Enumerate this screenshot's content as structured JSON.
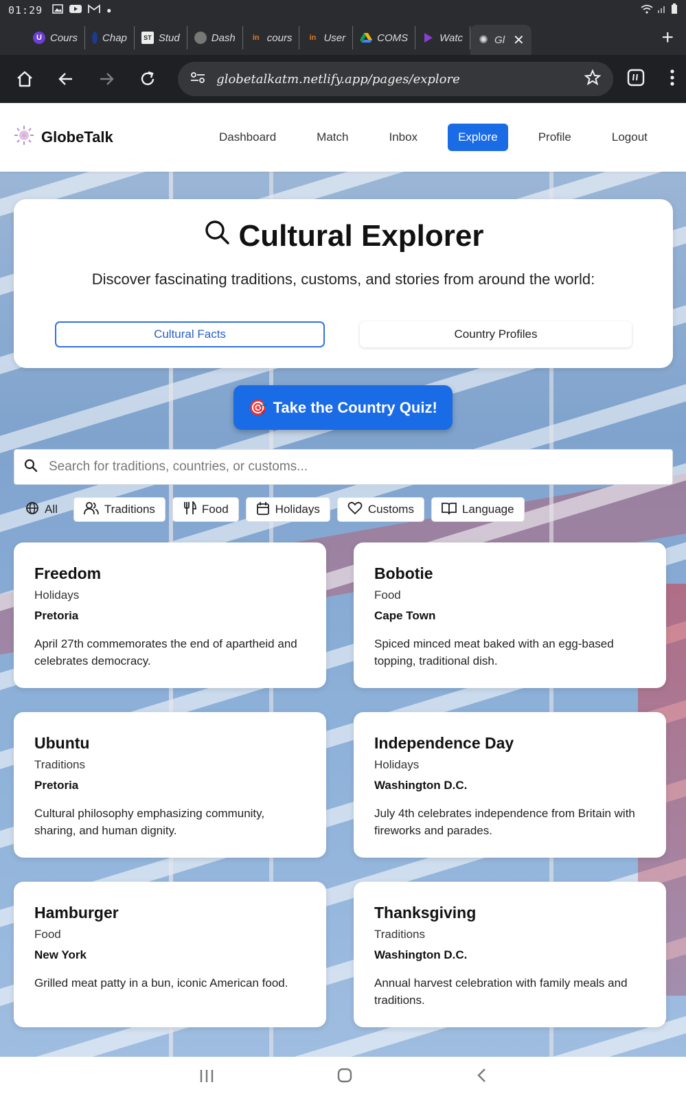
{
  "status": {
    "time": "01:29"
  },
  "tabs": [
    {
      "label": "Cours",
      "icon_color": "#6b3fd0",
      "glyph": "U"
    },
    {
      "label": "Chap",
      "icon_color": "#2b2c30",
      "glyph": ""
    },
    {
      "label": "Stud",
      "icon_color": "#e8e8e8",
      "glyph": "ST"
    },
    {
      "label": "Dash",
      "icon_color": "#777",
      "glyph": ""
    },
    {
      "label": "cours",
      "icon_color": "#c6591c",
      "glyph": "in"
    },
    {
      "label": "User",
      "icon_color": "#c6591c",
      "glyph": "in"
    },
    {
      "label": "COMS",
      "icon_color": "#2b8a3e",
      "glyph": ""
    },
    {
      "label": "Watc",
      "icon_color": "#8a3fd0",
      "glyph": ""
    },
    {
      "label": "Gl",
      "icon_color": "#999",
      "glyph": ""
    }
  ],
  "browser": {
    "url": "globetalkatm.netlify.app/pages/explore"
  },
  "app": {
    "brand": "GlobeTalk",
    "nav": [
      "Dashboard",
      "Match",
      "Inbox",
      "Explore",
      "Profile",
      "Logout"
    ],
    "active_nav": "Explore"
  },
  "explorer": {
    "title": "Cultural Explorer",
    "subtitle": "Discover fascinating traditions, customs, and stories from around the world:",
    "tab_facts": "Cultural Facts",
    "tab_profiles": "Country Profiles"
  },
  "quiz": {
    "emoji": "🎯",
    "label": "Take the Country Quiz!"
  },
  "search": {
    "placeholder": "Search for traditions, countries, or customs..."
  },
  "filters": [
    "All",
    "Traditions",
    "Food",
    "Holidays",
    "Customs",
    "Language"
  ],
  "facts": [
    {
      "title": "Freedom",
      "category": "Holidays",
      "city": "Pretoria",
      "description": "April 27th commemorates the end of apartheid and celebrates democracy."
    },
    {
      "title": "Bobotie",
      "category": "Food",
      "city": "Cape Town",
      "description": "Spiced minced meat baked with an egg-based topping, traditional dish."
    },
    {
      "title": "Ubuntu",
      "category": "Traditions",
      "city": "Pretoria",
      "description": "Cultural philosophy emphasizing community, sharing, and human dignity."
    },
    {
      "title": "Independence Day",
      "category": "Holidays",
      "city": "Washington D.C.",
      "description": "July 4th celebrates independence from Britain with fireworks and parades."
    },
    {
      "title": "Hamburger",
      "category": "Food",
      "city": "New York",
      "description": "Grilled meat patty in a bun, iconic American food."
    },
    {
      "title": "Thanksgiving",
      "category": "Traditions",
      "city": "Washington D.C.",
      "description": "Annual harvest celebration with family meals and traditions."
    }
  ],
  "colors": {
    "accent": "#1a6be6",
    "browser_bg": "#1f2023"
  }
}
